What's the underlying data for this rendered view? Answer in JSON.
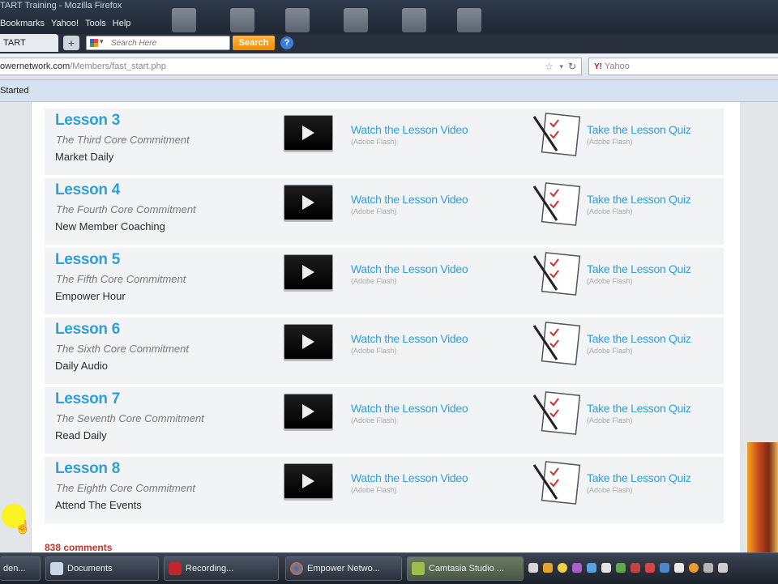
{
  "browser": {
    "window_title": "TART Training - Mozilla Firefox",
    "menu": [
      "Bookmarks",
      "Yahoo!",
      "Tools",
      "Help"
    ],
    "tab_label": "TART Training",
    "new_tab": "+",
    "search_placeholder": "Search Here",
    "search_button": "Search",
    "help_button": "?",
    "url_domain": "owernetwork.com",
    "url_path": "/Members/fast_start.php",
    "url_star": "☆",
    "url_dropdown": "▾",
    "url_reload": "↻",
    "yahoo_logo": "Y!",
    "yahoo_search_label": "Yahoo",
    "bookmark": "Started"
  },
  "lessons": [
    {
      "title": "Lesson 3",
      "subtitle": "The Third Core Commitment",
      "topic": "Market Daily"
    },
    {
      "title": "Lesson 4",
      "subtitle": "The Fourth Core Commitment",
      "topic": "New Member Coaching"
    },
    {
      "title": "Lesson 5",
      "subtitle": "The Fifth Core Commitment",
      "topic": "Empower Hour"
    },
    {
      "title": "Lesson 6",
      "subtitle": "The Sixth Core Commitment",
      "topic": "Daily Audio"
    },
    {
      "title": "Lesson 7",
      "subtitle": "The Seventh Core Commitment",
      "topic": "Read Daily"
    },
    {
      "title": "Lesson 8",
      "subtitle": "The Eighth Core Commitment",
      "topic": "Attend The Events"
    }
  ],
  "links": {
    "watch": "Watch the Lesson Video",
    "quiz": "Take the Lesson Quiz",
    "format": "(Adobe Flash)"
  },
  "comments_label": "838 comments",
  "taskbar": {
    "items": [
      "den...",
      "Documents",
      "Recording...",
      "Empower Netwo...",
      "Camtasia Studio ..."
    ]
  },
  "colors": {
    "link_blue": "#2f9fd8",
    "search_orange": "#f08a00",
    "comments_red": "#c0392b"
  }
}
